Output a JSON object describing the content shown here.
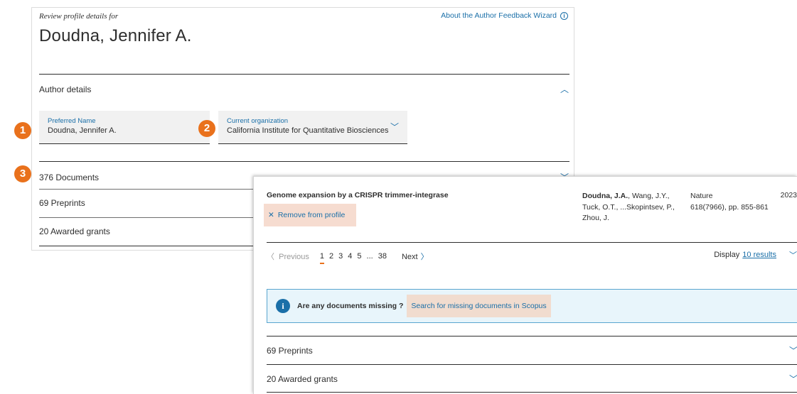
{
  "header": {
    "review_label": "Review profile details for",
    "about_link": "About the Author Feedback Wizard",
    "author_name": "Doudna, Jennifer A."
  },
  "author_details": {
    "title": "Author details",
    "preferred_name_label": "Preferred Name",
    "preferred_name_value": "Doudna, Jennifer A.",
    "organization_label": "Current organization",
    "organization_value": "California Institute for Quantitative Biosciences"
  },
  "badges": [
    "1",
    "2",
    "3"
  ],
  "sections": {
    "documents": "376 Documents",
    "preprints": "69 Preprints",
    "grants": "20 Awarded grants"
  },
  "document": {
    "title": "Genome expansion by a CRISPR trimmer-integrase",
    "remove_label": "Remove from profile",
    "authors_bold": "Doudna, J.A.",
    "authors_rest": ", Wang, J.Y., Tuck, O.T., ...Skopintsev, P., Zhou, J.",
    "source_line1": "Nature",
    "source_line2": "618(7966), pp. 855-861",
    "year": "2023"
  },
  "pagination": {
    "previous": "Previous",
    "pages": [
      "1",
      "2",
      "3",
      "4",
      "5",
      "...",
      "38"
    ],
    "next": "Next",
    "display_label": "Display",
    "display_value": "10 results"
  },
  "missing": {
    "question": "Are any documents missing ?",
    "link": "Search for missing documents in Scopus"
  },
  "front_sections": {
    "preprints": "69 Preprints",
    "grants": "20 Awarded grants"
  },
  "colors": {
    "accent_blue": "#1a6fa8",
    "badge_orange": "#e9711c",
    "highlight": "#f6dcd0"
  }
}
